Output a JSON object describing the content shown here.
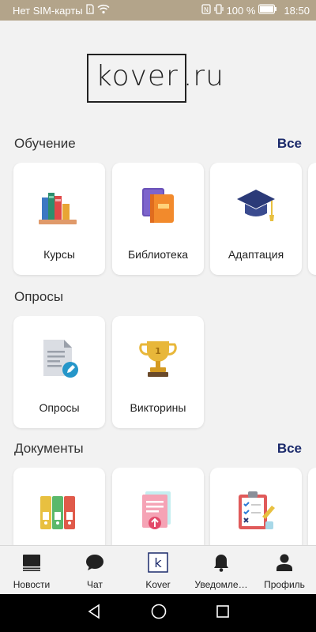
{
  "status_bar": {
    "carrier": "Нет SIM-карты",
    "battery": "100 %",
    "time": "18:50"
  },
  "logo": {
    "text": "kover",
    "suffix": ".ru"
  },
  "sections": {
    "learning": {
      "title": "Обучение",
      "all_label": "Все",
      "cards": [
        {
          "label": "Курсы",
          "icon": "books-icon"
        },
        {
          "label": "Библиотека",
          "icon": "library-book-icon"
        },
        {
          "label": "Адаптация",
          "icon": "graduation-cap-icon"
        }
      ]
    },
    "surveys": {
      "title": "Опросы",
      "cards": [
        {
          "label": "Опросы",
          "icon": "survey-document-icon"
        },
        {
          "label": "Викторины",
          "icon": "trophy-icon"
        }
      ]
    },
    "documents": {
      "title": "Документы",
      "all_label": "Все",
      "cards": [
        {
          "label": "",
          "icon": "binders-icon"
        },
        {
          "label": "",
          "icon": "document-upload-icon"
        },
        {
          "label": "",
          "icon": "checklist-icon"
        }
      ]
    }
  },
  "bottom_nav": [
    {
      "label": "Новости",
      "icon": "news-icon"
    },
    {
      "label": "Чат",
      "icon": "chat-icon"
    },
    {
      "label": "Kover",
      "icon": "kover-logo-icon",
      "icon_text": "k"
    },
    {
      "label": "Уведомле…",
      "icon": "bell-icon"
    },
    {
      "label": "Профиль",
      "icon": "profile-icon"
    }
  ],
  "colors": {
    "status_bar": "#b3a48a",
    "accent": "#1b2a6b",
    "background": "#f2f2f2"
  }
}
